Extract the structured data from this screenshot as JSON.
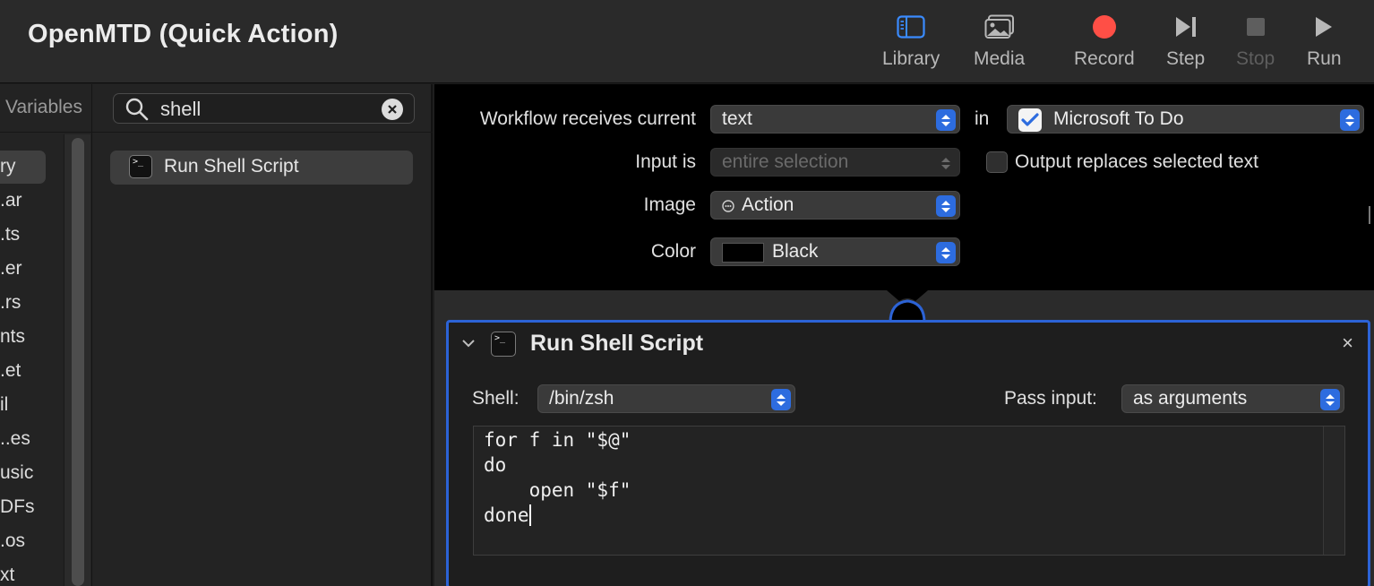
{
  "window": {
    "title": "OpenMTD (Quick Action)"
  },
  "toolbar": {
    "library": "Library",
    "media": "Media",
    "record": "Record",
    "step": "Step",
    "stop": "Stop",
    "run": "Run"
  },
  "sidebar": {
    "variables_tab": "Variables",
    "search": {
      "value": "shell"
    },
    "categories": [
      "ry",
      ".ar",
      ".ts",
      ".er",
      ".rs",
      "nts",
      ".et",
      "il",
      "..es",
      "usic",
      "DFs",
      ".os",
      "xt"
    ],
    "results": [
      {
        "label": "Run Shell Script",
        "icon": "terminal-icon"
      }
    ]
  },
  "workflow": {
    "receives_label": "Workflow receives current",
    "receives_value": "text",
    "in_label": "in",
    "app_value": "Microsoft To Do",
    "input_label": "Input is",
    "input_value": "entire selection",
    "output_label": "Output replaces selected text",
    "image_label": "Image",
    "image_value": "Action",
    "color_label": "Color",
    "color_value": "Black"
  },
  "action": {
    "title": "Run Shell Script",
    "close": "×",
    "shell_label": "Shell:",
    "shell_value": "/bin/zsh",
    "pass_label": "Pass input:",
    "pass_value": "as arguments",
    "script_lines": [
      "for f in \"$@\"",
      "do",
      "    open \"$f\"",
      "done"
    ]
  },
  "colors": {
    "accent": "#2d6cdf",
    "record": "#ff4f46",
    "card_border": "#2c63d6",
    "library_icon": "#3a8bff"
  }
}
